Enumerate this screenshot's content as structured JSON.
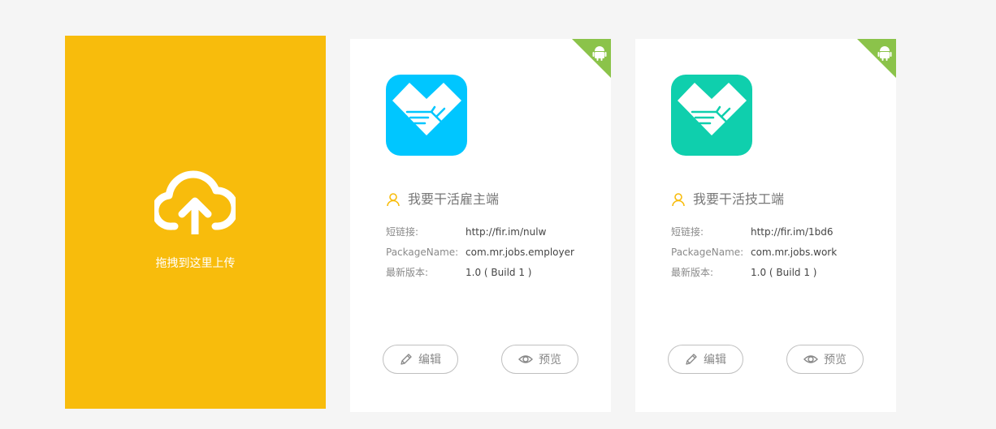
{
  "upload": {
    "label": "拖拽到这里上传",
    "icon": "cloud-upload-icon",
    "bg_color": "#f8bc0c"
  },
  "apps": [
    {
      "name": "我要干活雇主端",
      "icon": "handshake-heart-icon",
      "icon_color": "#00c6ff",
      "platform_icon": "android-icon",
      "short_link_label": "短链接:",
      "short_link": "http://fir.im/nulw",
      "package_label": "PackageName:",
      "package_name": "com.mr.jobs.employer",
      "version_label": "最新版本:",
      "version": "1.0 ( Build 1 )",
      "edit_label": "编辑",
      "preview_label": "预览"
    },
    {
      "name": "我要干活技工端",
      "icon": "handshake-heart-icon",
      "icon_color": "#0fcfad",
      "platform_icon": "android-icon",
      "short_link_label": "短链接:",
      "short_link": "http://fir.im/1bd6",
      "package_label": "PackageName:",
      "package_name": "com.mr.jobs.work",
      "version_label": "最新版本:",
      "version": "1.0 ( Build 1 )",
      "edit_label": "编辑",
      "preview_label": "预览"
    }
  ],
  "colors": {
    "corner_badge": "#8bc34a",
    "user_icon": "#f8bc0c"
  }
}
